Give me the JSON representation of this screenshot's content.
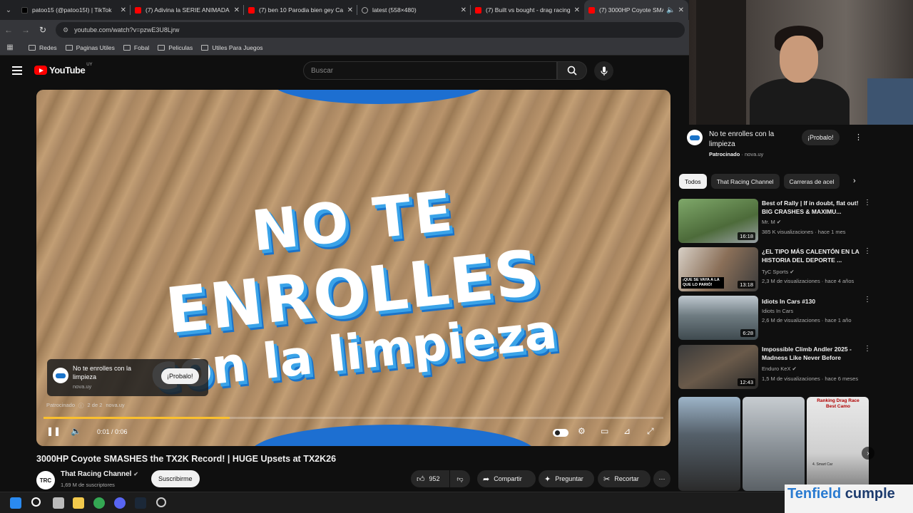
{
  "browser": {
    "tabs": [
      {
        "title": "patoo15 (@patoo15I) | TikTok",
        "color": "#000000"
      },
      {
        "title": "(7) Adivina la SERIE ANIMADA",
        "color": "#ff0000"
      },
      {
        "title": "(7) ben 10 Parodia bien gey Ca",
        "color": "#ff0000"
      },
      {
        "title": "latest (558×480)",
        "color": "#8ab4f8"
      },
      {
        "title": "(7) Built vs bought - drag racing",
        "color": "#ff0000"
      },
      {
        "title": "(7) 3000HP Coyote SMASH",
        "color": "#ff0000"
      }
    ],
    "url": "youtube.com/watch?v=pzwE3U8Ljrw",
    "bookmarks": [
      "Redes",
      "Paginas Utiles",
      "Fobal",
      "Peliculas",
      "Utiles Para Juegos"
    ]
  },
  "youtube": {
    "logo_text": "YouTube",
    "country_code": "UY",
    "search_placeholder": "Buscar"
  },
  "player": {
    "ad_line1": "NO TE",
    "ad_line2": "ENROLLES",
    "ad_line3": "con la limpieza",
    "ad_card": {
      "title": "No te enrolles con la limpieza",
      "domain": "nova.uy",
      "button": "¡Probalo!"
    },
    "sponsor_label": "Patrocinado",
    "sponsor_count": "2 de 2",
    "sponsor_domain": "nova.uy",
    "time": "0:01 / 0:06",
    "progress": 0.3
  },
  "video": {
    "title": "3000HP Coyote SMASHES the TX2K Record! | HUGE Upsets at TX2K26",
    "channel": "That Racing Channel",
    "channel_avatar": "TRC",
    "subscribers": "1,69 M de suscriptores",
    "subscribe_label": "Suscribirme",
    "likes": "952",
    "share_label": "Compartir",
    "ask_label": "Preguntar",
    "clip_label": "Recortar"
  },
  "sidebar": {
    "ad": {
      "title": "No te enrolles con la limpieza",
      "sponsored": "Patrocinado",
      "domain": "nova.uy",
      "button": "¡Probalo!"
    },
    "chips": [
      "Todos",
      "That Racing Channel",
      "Carreras de acel"
    ],
    "recommendations": [
      {
        "title": "Best of Rally | If in doubt, flat out! BIG CRASHES & MAXIMU...",
        "channel": "Mr. M",
        "stats": "385 K visualizaciones · hace 1 mes",
        "duration": "16:18",
        "verified": true
      },
      {
        "title": "¿EL TIPO MÁS CALENTÓN EN LA HISTORIA DEL DEPORTE ...",
        "channel": "TyC Sports",
        "stats": "2,3 M de visualizaciones · hace 4 años",
        "duration": "13:18",
        "verified": true
      },
      {
        "title": "Idiots In Cars #130",
        "channel": "Idiots In Cars",
        "stats": "2,6 M de visualizaciones · hace 1 año",
        "duration": "6:28",
        "verified": false
      },
      {
        "title": "Impossible Climb Andler 2025 - Madness Like Never Before",
        "channel": "Enduro KeX",
        "stats": "1,5 M de visualizaciones · hace 6 meses",
        "duration": "12:43",
        "verified": true
      }
    ],
    "thumb_caption_2": "¡QUE SE VAYA A LA QUE LO PARIÓ!",
    "shorts_caption": "Ranking Drag Race Best Camo",
    "shorts_sub": "4. Smart Car"
  },
  "overlay": {
    "brand": "Tenfield",
    "brand_tail": "cumple"
  },
  "colors": {
    "accent": "#ff0000",
    "progress": "#fbc02d",
    "ad_blue": "#1d6fd1"
  }
}
